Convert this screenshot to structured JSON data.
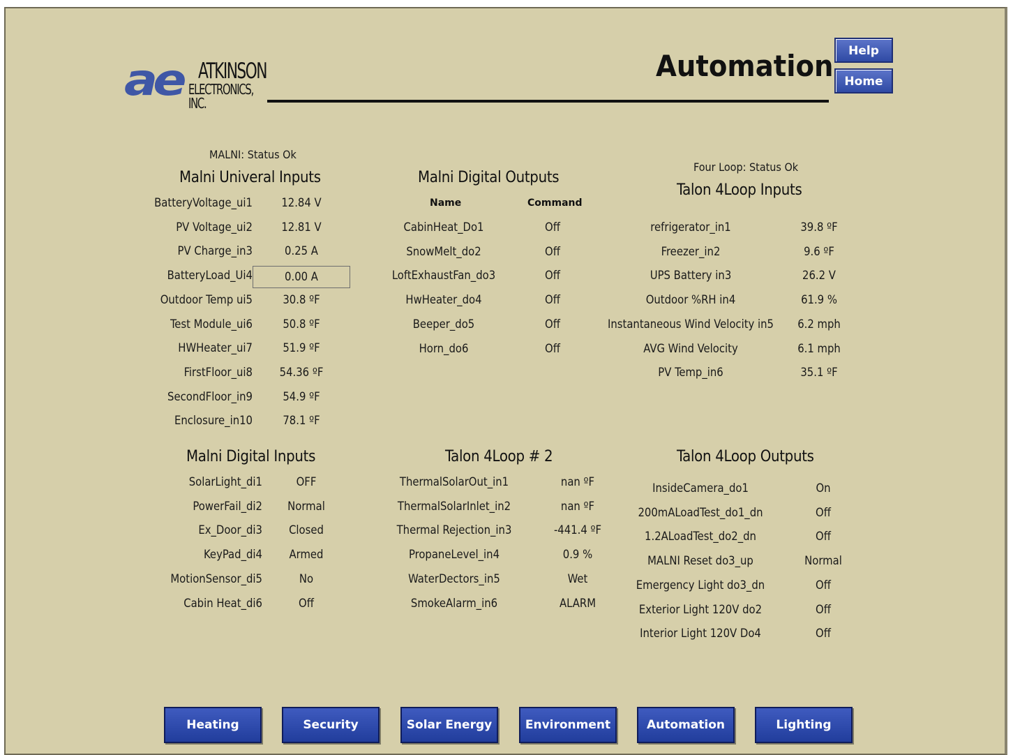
{
  "logo": {
    "mark": "ae",
    "line1": "ATKINSON",
    "line2": "ELECTRONICS, INC."
  },
  "header": {
    "title": "Automation",
    "help_label": "Help",
    "home_label": "Home"
  },
  "malni_universal": {
    "status": "MALNI: Status Ok",
    "title": "Malni Univeral Inputs",
    "rows": [
      {
        "label": "BatteryVoltage_ui1",
        "value": "12.84 V"
      },
      {
        "label": "PV Voltage_ui2",
        "value": "12.81 V"
      },
      {
        "label": "PV Charge_in3",
        "value": "0.25 A"
      },
      {
        "label": "BatteryLoad_Ui4",
        "value": "0.00 A"
      },
      {
        "label": "Outdoor Temp ui5",
        "value": "30.8 ºF"
      },
      {
        "label": "Test Module_ui6",
        "value": "50.8 ºF"
      },
      {
        "label": "HWHeater_ui7",
        "value": "51.9 ºF"
      },
      {
        "label": "FirstFloor_ui8",
        "value": "54.36 ºF"
      },
      {
        "label": "SecondFloor_in9",
        "value": "54.9 ºF"
      },
      {
        "label": "Enclosure_in10",
        "value": "78.1 ºF"
      }
    ]
  },
  "malni_digital_outputs": {
    "title": "Malni Digital Outputs",
    "col_name": "Name",
    "col_command": "Command",
    "rows": [
      {
        "label": "CabinHeat_Do1",
        "value": "Off"
      },
      {
        "label": "SnowMelt_do2",
        "value": "Off"
      },
      {
        "label": "LoftExhaustFan_do3",
        "value": "Off"
      },
      {
        "label": "HwHeater_do4",
        "value": "Off"
      },
      {
        "label": "Beeper_do5",
        "value": "Off"
      },
      {
        "label": "Horn_do6",
        "value": "Off"
      }
    ]
  },
  "talon_inputs": {
    "status": "Four Loop: Status Ok",
    "title": "Talon 4Loop Inputs",
    "rows": [
      {
        "label": "refrigerator_in1",
        "value": "39.8 ºF"
      },
      {
        "label": "Freezer_in2",
        "value": "9.6 ºF"
      },
      {
        "label": "UPS Battery in3",
        "value": "26.2 V"
      },
      {
        "label": "Outdoor %RH in4",
        "value": "61.9 %"
      },
      {
        "label": "Instantaneous Wind Velocity in5",
        "value": "6.2 mph"
      },
      {
        "label": "AVG Wind Velocity",
        "value": "6.1 mph"
      },
      {
        "label": "PV Temp_in6",
        "value": "35.1 ºF"
      }
    ]
  },
  "malni_digital_inputs": {
    "title": "Malni Digital Inputs",
    "rows": [
      {
        "label": "SolarLight_di1",
        "value": "OFF"
      },
      {
        "label": "PowerFail_di2",
        "value": "Normal"
      },
      {
        "label": "Ex_Door_di3",
        "value": "Closed"
      },
      {
        "label": "KeyPad_di4",
        "value": "Armed"
      },
      {
        "label": "MotionSensor_di5",
        "value": "No"
      },
      {
        "label": "Cabin Heat_di6",
        "value": "Off"
      }
    ]
  },
  "talon_loop2": {
    "title": "Talon 4Loop # 2",
    "rows": [
      {
        "label": "ThermalSolarOut_in1",
        "value": "nan ºF"
      },
      {
        "label": "ThermalSolarInlet_in2",
        "value": "nan ºF"
      },
      {
        "label": "Thermal Rejection_in3",
        "value": "-441.4 ºF"
      },
      {
        "label": "PropaneLevel_in4",
        "value": "0.9 %"
      },
      {
        "label": "WaterDectors_in5",
        "value": "Wet"
      },
      {
        "label": "SmokeAlarm_in6",
        "value": "ALARM"
      }
    ]
  },
  "talon_outputs": {
    "title": "Talon 4Loop Outputs",
    "rows": [
      {
        "label": "InsideCamera_do1",
        "value": "On"
      },
      {
        "label": "200mALoadTest_do1_dn",
        "value": "Off"
      },
      {
        "label": "1.2ALoadTest_do2_dn",
        "value": "Off"
      },
      {
        "label": "MALNI Reset do3_up",
        "value": "Normal"
      },
      {
        "label": "Emergency Light do3_dn",
        "value": "Off"
      },
      {
        "label": "Exterior Light 120V do2",
        "value": "Off"
      },
      {
        "label": "Interior Light 120V Do4",
        "value": "Off"
      }
    ]
  },
  "nav": [
    "Heating",
    "Security",
    "Solar Energy",
    "Environment",
    "Automation",
    "Lighting"
  ],
  "colors": {
    "background": "#d6cfaa",
    "button": "#2f4aa4",
    "logo": "#3f57a6"
  }
}
